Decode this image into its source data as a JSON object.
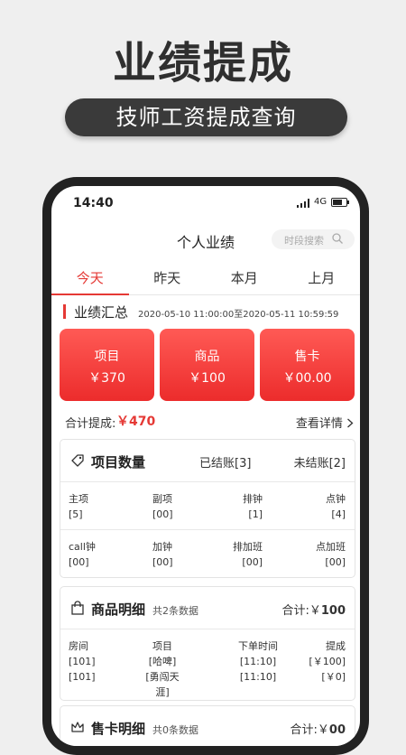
{
  "promo": {
    "title": "业绩提成",
    "subtitle": "技师工资提成查询"
  },
  "status": {
    "time": "14:40",
    "network": "4G",
    "battery_level": 0.7
  },
  "nav": {
    "title": "个人业绩",
    "search_placeholder": "时段搜索"
  },
  "tabs": [
    {
      "label": "今天",
      "active": true
    },
    {
      "label": "昨天",
      "active": false
    },
    {
      "label": "本月",
      "active": false
    },
    {
      "label": "上月",
      "active": false
    }
  ],
  "summary": {
    "title": "业绩汇总",
    "range": "2020-05-10 11:00:00至2020-05-11 10:59:59",
    "cards": [
      {
        "label": "项目",
        "value": "￥370"
      },
      {
        "label": "商品",
        "value": "￥100"
      },
      {
        "label": "售卡",
        "value": "￥00.00"
      }
    ],
    "total_label": "合计提成:",
    "total_value": "￥470",
    "detail_link": "查看详情"
  },
  "project_count": {
    "title": "项目数量",
    "settled": "已结账[3]",
    "unsettled": "未结账[2]",
    "row1": [
      {
        "label": "主项",
        "value": "[5]"
      },
      {
        "label": "副项",
        "value": "[00]"
      },
      {
        "label": "排钟",
        "value": "[1]"
      },
      {
        "label": "点钟",
        "value": "[4]"
      }
    ],
    "row2": [
      {
        "label": "call钟",
        "value": "[00]"
      },
      {
        "label": "加钟",
        "value": "[00]"
      },
      {
        "label": "排加班",
        "value": "[00]"
      },
      {
        "label": "点加班",
        "value": "[00]"
      }
    ]
  },
  "goods": {
    "title": "商品明细",
    "count": "共2条数据",
    "total_label": "合计:￥",
    "total_value": "100",
    "columns": [
      "房间",
      "项目",
      "下单时间",
      "提成"
    ],
    "rows": [
      [
        "[101]",
        "[哈啤]",
        "[11:10]",
        "[￥100]"
      ],
      [
        "[101]",
        "[勇闯天涯]",
        "[11:10]",
        "[￥0]"
      ]
    ]
  },
  "cards_detail": {
    "title": "售卡明细",
    "count": "共0条数据",
    "total_label": "合计:￥",
    "total_value": "00"
  }
}
